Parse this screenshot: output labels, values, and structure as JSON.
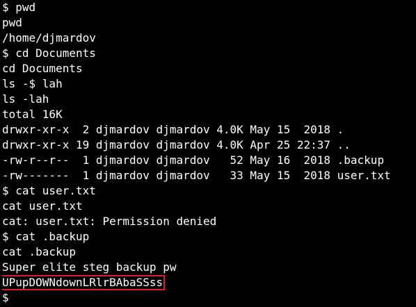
{
  "terminal": {
    "lines": [
      "$ pwd",
      "pwd",
      "/home/djmardov",
      "$ cd Documents",
      "cd Documents",
      "ls -$ lah",
      "ls -lah",
      "total 16K",
      "drwxr-xr-x  2 djmardov djmardov 4.0K May 15  2018 .",
      "drwxr-xr-x 19 djmardov djmardov 4.0K Apr 25 22:37 ..",
      "-rw-r--r--  1 djmardov djmardov   52 May 16  2018 .backup",
      "-rw-------  1 djmardov djmardov   33 May 15  2018 user.txt",
      "$ cat user.txt",
      "cat user.txt",
      "cat: user.txt: Permission denied",
      "$ cat .backup",
      "cat .backup",
      "Super elite steg backup pw",
      "UPupDOWNdownLRlrBAbaSSss",
      "$"
    ],
    "highlight_color": "#e11d2a",
    "background_color": "#000000",
    "text_color": "#ffffff"
  }
}
